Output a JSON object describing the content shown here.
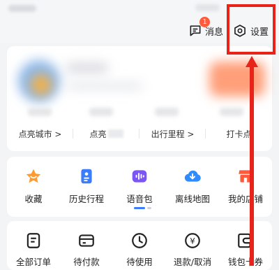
{
  "header": {
    "messages_label": "消息",
    "messages_badge": "1",
    "settings_label": "设置"
  },
  "stats": [
    "点亮城市 >",
    "点亮",
    "出行里程 >",
    "打卡点"
  ],
  "tools": [
    {
      "label": "收藏",
      "icon": "star-icon"
    },
    {
      "label": "历史行程",
      "icon": "history-icon"
    },
    {
      "label": "语音包",
      "icon": "voice-icon"
    },
    {
      "label": "离线地图",
      "icon": "offline-map-icon"
    },
    {
      "label": "我的店铺",
      "icon": "store-icon"
    }
  ],
  "orders": [
    {
      "label": "全部订单",
      "icon": "all-orders-icon"
    },
    {
      "label": "待付款",
      "icon": "pending-payment-icon"
    },
    {
      "label": "待使用",
      "icon": "pending-use-icon"
    },
    {
      "label": "退款/取消",
      "icon": "refund-icon"
    },
    {
      "label": "钱包卡券",
      "icon": "wallet-icon"
    }
  ],
  "colors": {
    "accent": "#3b7dfa",
    "highlight": "#e8231a",
    "star": "#ff9a2e",
    "voice": "#7b55f5",
    "offline": "#2f8cff",
    "store": "#ff5a3c"
  }
}
